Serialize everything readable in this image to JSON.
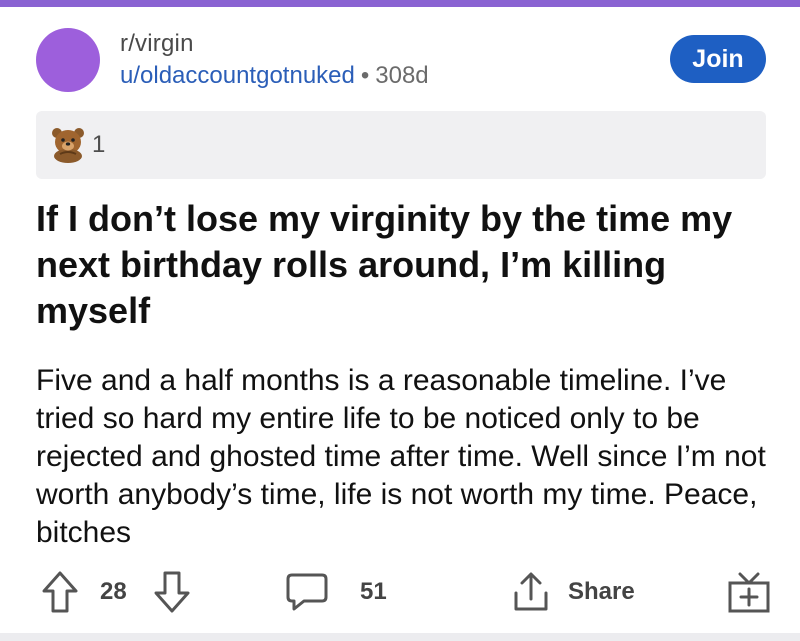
{
  "post": {
    "subreddit": "r/virgin",
    "username": "u/oldaccountgotnuked",
    "separator": "•",
    "age": "308d",
    "join_label": "Join",
    "award_count": "1",
    "award_icon": "bear-award-icon",
    "title": "If I don’t lose my virginity by the time my next birthday rolls around, I’m killing myself",
    "body": "Five and a half months is a reasonable timeline. I’ve tried so hard my entire life to be noticed only to be rejected and ghosted time after time. Well since I’m not worth anybody’s time, life is not worth my time. Peace, bitches"
  },
  "actions": {
    "upvotes": "28",
    "comments": "51",
    "share_label": "Share"
  },
  "colors": {
    "accent": "#8a63d2",
    "avatar": "#9d5fdc",
    "join_button": "#1e5fc3",
    "username": "#2b5eb8"
  }
}
